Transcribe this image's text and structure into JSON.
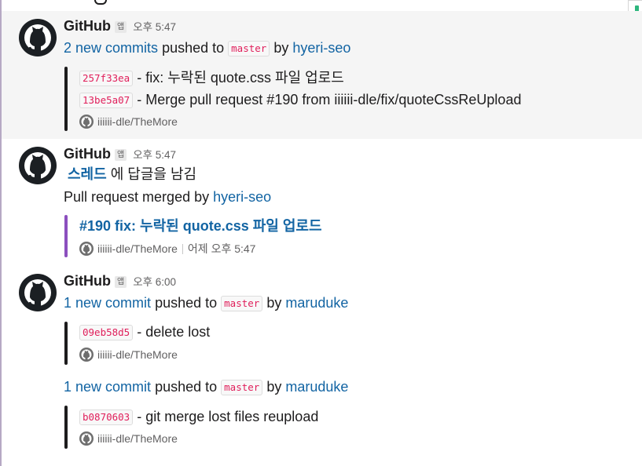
{
  "messages": [
    {
      "sender": "GitHub",
      "app_badge": "앱",
      "time": "오후 5:47",
      "push": {
        "commit_count": "2 new commits",
        "pushed_to": "pushed to",
        "branch": "master",
        "by": "by",
        "author": "hyeri-seo"
      },
      "commits": [
        {
          "hash": "257f33ea",
          "message": "- fix: 누락된 quote.css 파일 업로드"
        },
        {
          "hash": "13be5a07",
          "message": "- Merge pull request #190 from iiiiii-dle/fix/quoteCssReUpload"
        }
      ],
      "repo": "iiiiii-dle/TheMore"
    },
    {
      "sender": "GitHub",
      "app_badge": "앱",
      "time": "오후 5:47",
      "thread_link": "스레드",
      "thread_suffix": "에 답글을 남김",
      "merged_prefix": "Pull request merged by",
      "merged_author": "hyeri-seo",
      "pr_title": "#190 fix: 누락된 quote.css 파일 업로드",
      "repo": "iiiiii-dle/TheMore",
      "pr_time": "어제 오후 5:47"
    },
    {
      "sender": "GitHub",
      "app_badge": "앱",
      "time": "오후 6:00",
      "pushes": [
        {
          "commit_count": "1 new commit",
          "pushed_to": "pushed to",
          "branch": "master",
          "by": "by",
          "author": "maruduke",
          "commits": [
            {
              "hash": "09eb58d5",
              "message": "- delete lost"
            }
          ],
          "repo": "iiiiii-dle/TheMore"
        },
        {
          "commit_count": "1 new commit",
          "pushed_to": "pushed to",
          "branch": "master",
          "by": "by",
          "author": "maruduke",
          "commits": [
            {
              "hash": "b0870603",
              "message": "- git merge lost files reupload"
            }
          ],
          "repo": "iiiiii-dle/TheMore"
        }
      ]
    }
  ],
  "colors": {
    "link": "#1264a3",
    "code_text": "#e01e5a",
    "highlight_bg": "#f5f5f5",
    "pr_bar": "#8c4fbe",
    "commit_bar": "#1d1c1d"
  },
  "icons": {
    "avatar": "github-octocat-icon",
    "repo": "github-mini-icon"
  }
}
